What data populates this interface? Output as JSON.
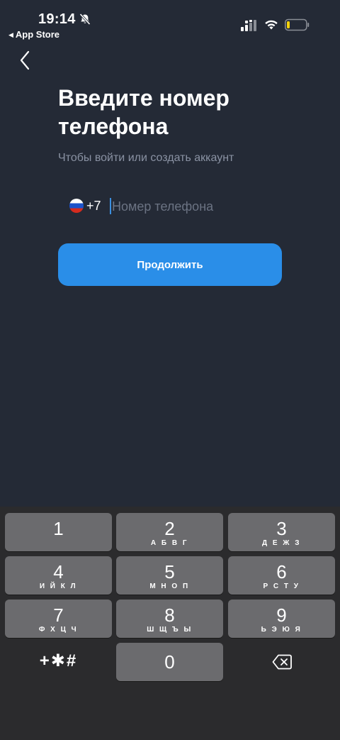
{
  "status_bar": {
    "time": "19:14",
    "back_to_app": "App Store",
    "back_to_app_icon": "triangle-left-icon"
  },
  "header": {
    "back_icon": "chevron-left-icon"
  },
  "main": {
    "title": "Введите номер телефона",
    "subtitle": "Чтобы войти или создать аккаунт",
    "phone": {
      "country_flag": "russia-flag-icon",
      "country_code": "+7",
      "value": "",
      "placeholder": "Номер телефона",
      "caret_color": "#3b8fe0"
    },
    "continue_label": "Продолжить",
    "accent_color": "#2a8ee8"
  },
  "keyboard": {
    "keys": [
      {
        "digit": "1",
        "letters": ""
      },
      {
        "digit": "2",
        "letters": "А Б В Г"
      },
      {
        "digit": "3",
        "letters": "Д Е Ж З"
      },
      {
        "digit": "4",
        "letters": "И Й К Л"
      },
      {
        "digit": "5",
        "letters": "М Н О П"
      },
      {
        "digit": "6",
        "letters": "Р С Т У"
      },
      {
        "digit": "7",
        "letters": "Ф Х Ц Ч"
      },
      {
        "digit": "8",
        "letters": "Ш Щ Ъ Ы"
      },
      {
        "digit": "9",
        "letters": "Ь Э Ю Я"
      },
      {
        "digit": "0",
        "letters": ""
      }
    ],
    "symbols_label": "+✱#",
    "delete_icon": "backspace-icon"
  }
}
